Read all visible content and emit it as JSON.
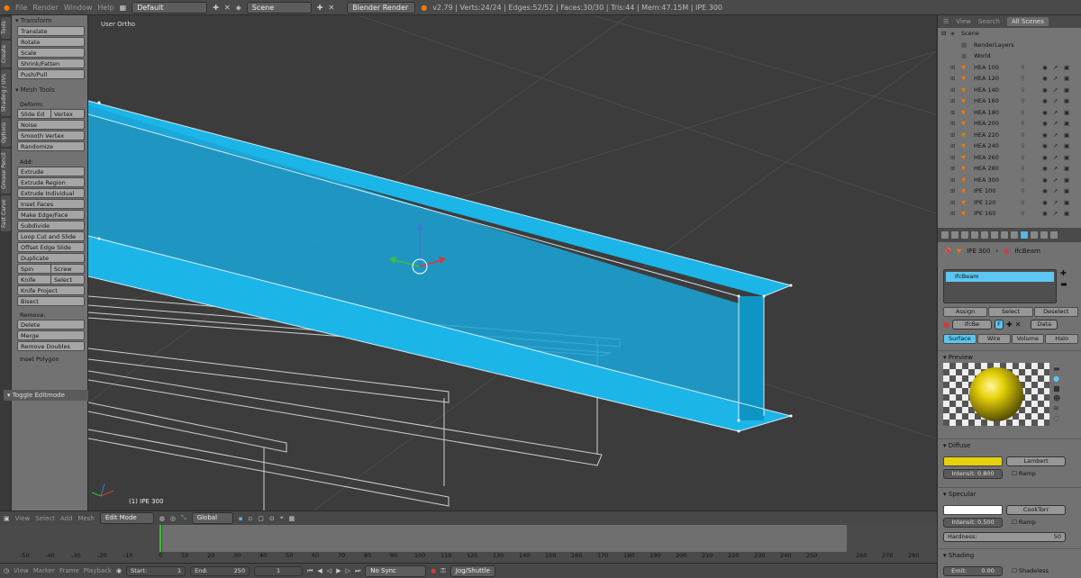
{
  "topbar": {
    "menus": [
      "File",
      "Render",
      "Window",
      "Help"
    ],
    "screen_layout": "Default",
    "scene": "Scene",
    "render_engine": "Blender Render",
    "stats": "v2.79 | Verts:24/24 | Edges:52/52 | Faces:30/30 | Tris:44 | Mem:47.15M | IPE 300"
  },
  "left_tabs": [
    "Tools",
    "Create",
    "Shading / UVs",
    "Options",
    "Grease Pencil",
    "Fast Carve"
  ],
  "toolshelf": {
    "transform_header": "Transform",
    "transform": [
      "Translate",
      "Rotate",
      "Scale",
      "Shrink/Fatten",
      "Push/Pull"
    ],
    "mesh_tools_header": "Mesh Tools",
    "deform_label": "Deform:",
    "deform_row": [
      "Slide Ed",
      "Vertex"
    ],
    "deform": [
      "Noise",
      "Smooth Vertex",
      "Randomize"
    ],
    "add_label": "Add:",
    "add": [
      "Extrude",
      "Extrude Region",
      "Extrude Individual",
      "Inset Faces",
      "Make Edge/Face",
      "Subdivide",
      "Loop Cut and Slide",
      "Offset Edge Slide",
      "Duplicate"
    ],
    "spin_row": [
      "Spin",
      "Screw"
    ],
    "knife_row": [
      "Knife",
      "Select"
    ],
    "knife_project": "Knife Project",
    "bisect": "Bisect",
    "remove_label": "Remove:",
    "remove": [
      "Delete",
      "Merge",
      "Remove Doubles"
    ],
    "inset_polygon": "Inset Polygon",
    "toggle_editmode": "Toggle Editmode"
  },
  "viewport": {
    "view_label": "User Ortho",
    "object_label": "(1) IPE 300",
    "beam_color": "#1cb5e8"
  },
  "viewport_header": {
    "menus": [
      "View",
      "Select",
      "Add",
      "Mesh"
    ],
    "mode": "Edit Mode",
    "orientation": "Global"
  },
  "timeline": {
    "ticks": [
      "-50",
      "-40",
      "-30",
      "-20",
      "-10",
      "0",
      "10",
      "20",
      "30",
      "40",
      "50",
      "60",
      "70",
      "80",
      "90",
      "100",
      "110",
      "120",
      "130",
      "140",
      "150",
      "160",
      "170",
      "180",
      "190",
      "200",
      "210",
      "220",
      "230",
      "240",
      "250",
      "260",
      "270",
      "280"
    ],
    "menus": [
      "View",
      "Marker",
      "Frame",
      "Playback"
    ],
    "start_label": "Start:",
    "start_value": "1",
    "end_label": "End:",
    "end_value": "250",
    "current_frame": "1",
    "sync": "No Sync",
    "keying": "Jog/Shuttle"
  },
  "outliner": {
    "tabs": [
      "View",
      "Search",
      "All Scenes"
    ],
    "scene": "Scene",
    "render_layers": "RenderLayers",
    "world": "World",
    "objects": [
      "HEA 100",
      "HEA 120",
      "HEA 140",
      "HEA 160",
      "HEA 180",
      "HEA 200",
      "HEA 220",
      "HEA 240",
      "HEA 260",
      "HEA 280",
      "HEA 300",
      "IPE 100",
      "IPE 120",
      "IPE 160"
    ]
  },
  "properties": {
    "breadcrumb_object": "IPE 300",
    "breadcrumb_material": "IfcBeam",
    "material_slot": "IfcBeam",
    "assign": "Assign",
    "select": "Select",
    "deselect": "Deselect",
    "material_name": "IfcBe",
    "users": "F",
    "data_select": "Data",
    "tabs": [
      "Surface",
      "Wire",
      "Volume",
      "Halo"
    ],
    "preview_header": "Preview",
    "diffuse_header": "Diffuse",
    "diffuse_color": "#e6d20a",
    "diffuse_shader": "Lambert",
    "diffuse_intensity": "Intensit: 0.800",
    "ramp": "Ramp",
    "specular_header": "Specular",
    "specular_color": "#ffffff",
    "specular_shader": "CookTorr",
    "specular_intensity": "Intensit: 0.500",
    "hardness": "Hardness:",
    "hardness_value": "50",
    "shading_header": "Shading",
    "emit": "Emit:",
    "emit_value": "0.00",
    "shadeless": "Shadeless"
  }
}
